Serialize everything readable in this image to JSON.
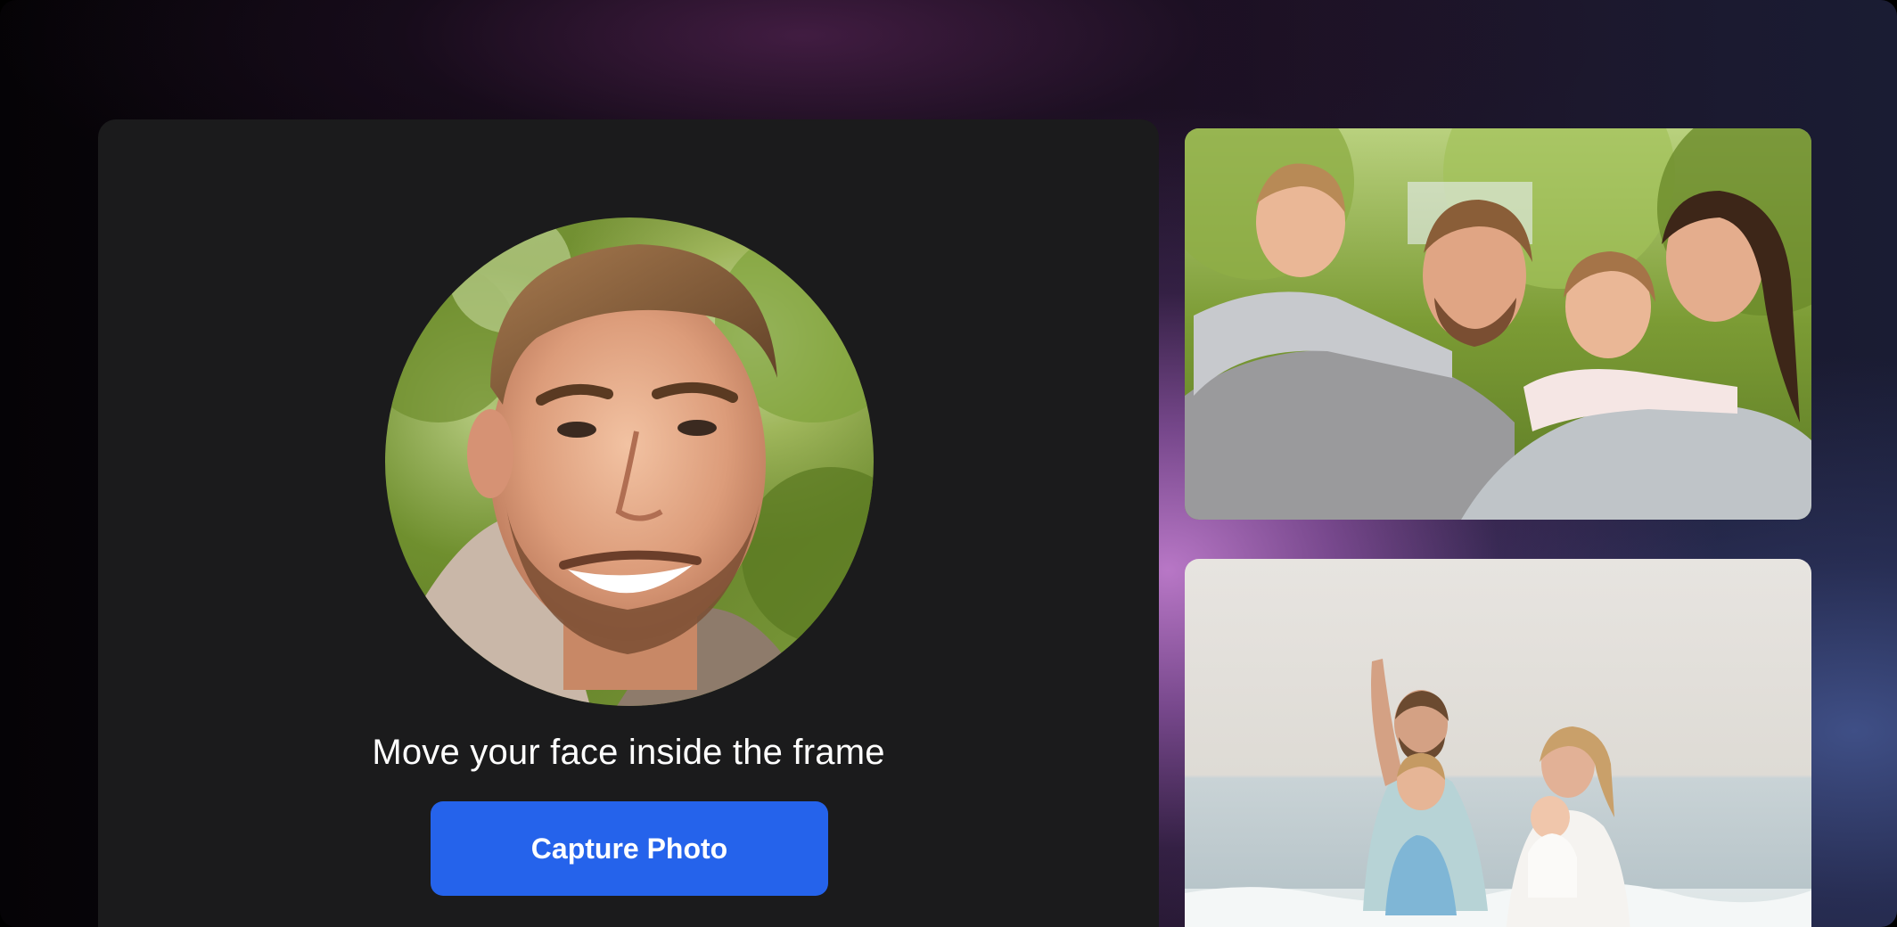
{
  "capture": {
    "instruction": "Move your face inside the frame",
    "button_label": "Capture Photo"
  },
  "photos": [
    {
      "subject": "family-park-photo"
    },
    {
      "subject": "family-beach-photo"
    }
  ],
  "colors": {
    "panel": "#1b1b1c",
    "accent": "#2563eb",
    "text": "#ffffff"
  }
}
